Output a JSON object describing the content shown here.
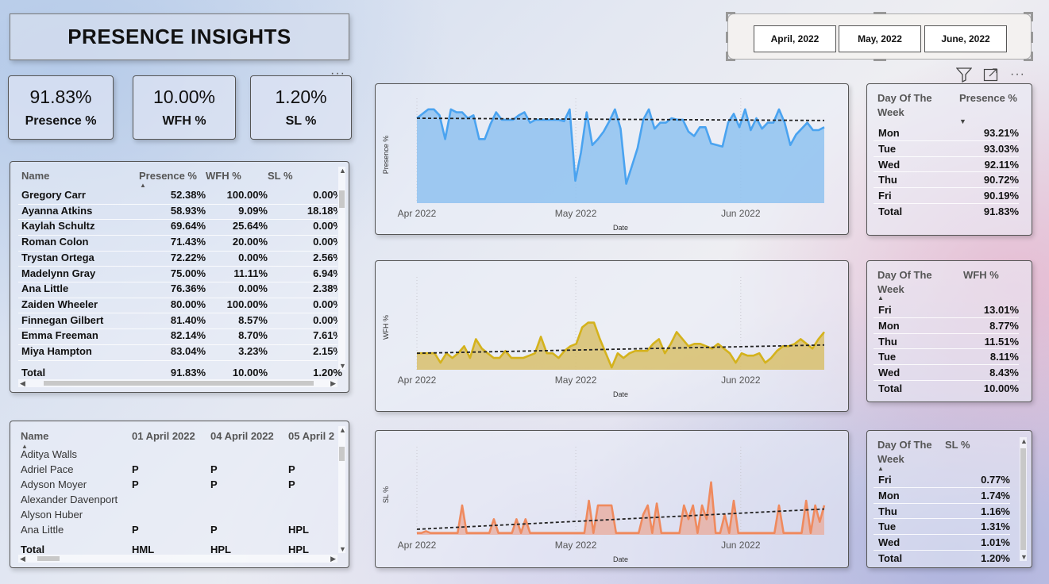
{
  "title": "PRESENCE INSIGHTS",
  "kpis": [
    {
      "value": "91.83%",
      "label": "Presence %"
    },
    {
      "value": "10.00%",
      "label": "WFH %"
    },
    {
      "value": "1.20%",
      "label": "SL %"
    }
  ],
  "slicer": {
    "options": [
      "April, 2022",
      "May, 2022",
      "June, 2022"
    ]
  },
  "employee_table": {
    "columns": [
      "Name",
      "Presence %",
      "WFH %",
      "SL %"
    ],
    "rows": [
      [
        "Gregory Carr",
        "52.38%",
        "100.00%",
        "0.00%"
      ],
      [
        "Ayanna Atkins",
        "58.93%",
        "9.09%",
        "18.18%"
      ],
      [
        "Kaylah Schultz",
        "69.64%",
        "25.64%",
        "0.00%"
      ],
      [
        "Roman Colon",
        "71.43%",
        "20.00%",
        "0.00%"
      ],
      [
        "Trystan Ortega",
        "72.22%",
        "0.00%",
        "2.56%"
      ],
      [
        "Madelynn Gray",
        "75.00%",
        "11.11%",
        "6.94%"
      ],
      [
        "Ana Little",
        "76.36%",
        "0.00%",
        "2.38%"
      ],
      [
        "Zaiden Wheeler",
        "80.00%",
        "100.00%",
        "0.00%"
      ],
      [
        "Finnegan Gilbert",
        "81.40%",
        "8.57%",
        "0.00%"
      ],
      [
        "Emma Freeman",
        "82.14%",
        "8.70%",
        "7.61%"
      ],
      [
        "Miya Hampton",
        "83.04%",
        "3.23%",
        "2.15%"
      ]
    ],
    "total": [
      "Total",
      "91.83%",
      "10.00%",
      "1.20%"
    ]
  },
  "attendance_table": {
    "columns": [
      "Name",
      "01 April 2022",
      "04 April 2022",
      "05 April 2"
    ],
    "rows": [
      [
        "Aditya Walls",
        "",
        "",
        ""
      ],
      [
        "Adriel Pace",
        "P",
        "P",
        "P"
      ],
      [
        "Adyson Moyer",
        "P",
        "P",
        "P"
      ],
      [
        "Alexander Davenport",
        "",
        "",
        ""
      ],
      [
        "Alyson Huber",
        "",
        "",
        ""
      ],
      [
        "Ana Little",
        "P",
        "P",
        "HPL"
      ]
    ],
    "total": [
      "Total",
      "HML",
      "HPL",
      "HPL"
    ]
  },
  "icons": {
    "filter": "filter-icon",
    "focus": "focus-mode-icon",
    "more": "more-options-icon"
  },
  "chart_data": [
    {
      "type": "area",
      "ylabel": "Presence %",
      "xlabel": "Date",
      "x_ticks": [
        "Apr 2022",
        "May 2022",
        "Jun 2022"
      ],
      "color": "#4aa3f0",
      "fill": "#8fc2f0",
      "trend": [
        0.92,
        0.905
      ],
      "ylim": [
        0.35,
        1.0
      ],
      "values": [
        0.92,
        0.95,
        0.98,
        0.98,
        0.94,
        0.78,
        0.98,
        0.96,
        0.96,
        0.92,
        0.94,
        0.78,
        0.78,
        0.88,
        0.96,
        0.91,
        0.91,
        0.91,
        0.94,
        0.96,
        0.89,
        0.91,
        0.91,
        0.91,
        0.91,
        0.91,
        0.9,
        0.98,
        0.5,
        0.69,
        0.96,
        0.74,
        0.78,
        0.83,
        0.9,
        0.98,
        0.85,
        0.48,
        0.6,
        0.72,
        0.91,
        0.98,
        0.85,
        0.89,
        0.89,
        0.92,
        0.91,
        0.91,
        0.83,
        0.8,
        0.86,
        0.86,
        0.75,
        0.74,
        0.73,
        0.89,
        0.95,
        0.86,
        0.98,
        0.84,
        0.92,
        0.85,
        0.89,
        0.89,
        0.98,
        0.89,
        0.74,
        0.81,
        0.85,
        0.89,
        0.84,
        0.84,
        0.86
      ]
    },
    {
      "type": "area",
      "ylabel": "WFH %",
      "xlabel": "Date",
      "x_ticks": [
        "Apr 2022",
        "May 2022",
        "Jun 2022"
      ],
      "color": "#d4b21c",
      "fill": "#d8c06c",
      "trend": [
        0.07,
        0.105
      ],
      "ylim": [
        0.0,
        0.36
      ],
      "values": [
        0.07,
        0.07,
        0.07,
        0.07,
        0.03,
        0.07,
        0.05,
        0.07,
        0.1,
        0.05,
        0.13,
        0.09,
        0.07,
        0.05,
        0.05,
        0.08,
        0.05,
        0.05,
        0.05,
        0.06,
        0.07,
        0.14,
        0.07,
        0.07,
        0.05,
        0.08,
        0.1,
        0.11,
        0.18,
        0.2,
        0.2,
        0.13,
        0.07,
        0.01,
        0.07,
        0.05,
        0.07,
        0.08,
        0.08,
        0.08,
        0.11,
        0.13,
        0.07,
        0.11,
        0.16,
        0.13,
        0.1,
        0.11,
        0.11,
        0.1,
        0.09,
        0.11,
        0.09,
        0.07,
        0.03,
        0.07,
        0.06,
        0.06,
        0.07,
        0.03,
        0.05,
        0.08,
        0.1,
        0.1,
        0.11,
        0.13,
        0.11,
        0.09,
        0.13,
        0.16
      ]
    },
    {
      "type": "area",
      "ylabel": "SL %",
      "xlabel": "Date",
      "x_ticks": [
        "Apr 2022",
        "May 2022",
        "Jun 2022"
      ],
      "color": "#ef8a5e",
      "fill": "#e8b0a4",
      "trend": [
        0.004,
        0.026
      ],
      "ylim": [
        -0.002,
        0.085
      ],
      "values": [
        0.0,
        0.0,
        0.002,
        0.0,
        0.0,
        0.0,
        0.0,
        0.0,
        0.0,
        0.0,
        0.03,
        0.0,
        0.0,
        0.0,
        0.0,
        0.0,
        0.0,
        0.015,
        0.0,
        0.0,
        0.0,
        0.0,
        0.015,
        0.0,
        0.015,
        0.0,
        0.0,
        0.0,
        0.0,
        0.0,
        0.0,
        0.0,
        0.0,
        0.0,
        0.0,
        0.0,
        0.0,
        0.0,
        0.035,
        0.0,
        0.03,
        0.03,
        0.03,
        0.03,
        0.0,
        0.0,
        0.0,
        0.0,
        0.0,
        0.0,
        0.02,
        0.03,
        0.0,
        0.032,
        0.0,
        0.0,
        0.0,
        0.0,
        0.0,
        0.03,
        0.015,
        0.03,
        0.0,
        0.03,
        0.015,
        0.055,
        0.0,
        0.0,
        0.02,
        0.0,
        0.035,
        0.0,
        0.0,
        0.0,
        0.0,
        0.0,
        0.0,
        0.0,
        0.0,
        0.0,
        0.03,
        0.0,
        0.0,
        0.0,
        0.0,
        0.0,
        0.035,
        0.0,
        0.03,
        0.012,
        0.03
      ]
    }
  ],
  "day_tables": [
    {
      "header": [
        "Day Of The",
        "Week",
        "Presence %"
      ],
      "sort": "down",
      "rows": [
        [
          "Mon",
          "93.21%"
        ],
        [
          "Tue",
          "93.03%"
        ],
        [
          "Wed",
          "92.11%"
        ],
        [
          "Thu",
          "90.72%"
        ],
        [
          "Fri",
          "90.19%"
        ]
      ],
      "total": [
        "Total",
        "91.83%"
      ]
    },
    {
      "header": [
        "Day Of The",
        "Week",
        "WFH %"
      ],
      "sort": "up",
      "rows": [
        [
          "Fri",
          "13.01%"
        ],
        [
          "Mon",
          "8.77%"
        ],
        [
          "Thu",
          "11.51%"
        ],
        [
          "Tue",
          "8.11%"
        ],
        [
          "Wed",
          "8.43%"
        ]
      ],
      "total": [
        "Total",
        "10.00%"
      ]
    },
    {
      "header": [
        "Day Of The",
        "Week",
        "SL %"
      ],
      "sort": "up",
      "rows": [
        [
          "Fri",
          "0.77%"
        ],
        [
          "Mon",
          "1.74%"
        ],
        [
          "Thu",
          "1.16%"
        ],
        [
          "Tue",
          "1.31%"
        ],
        [
          "Wed",
          "1.01%"
        ]
      ],
      "total": [
        "Total",
        "1.20%"
      ]
    }
  ]
}
